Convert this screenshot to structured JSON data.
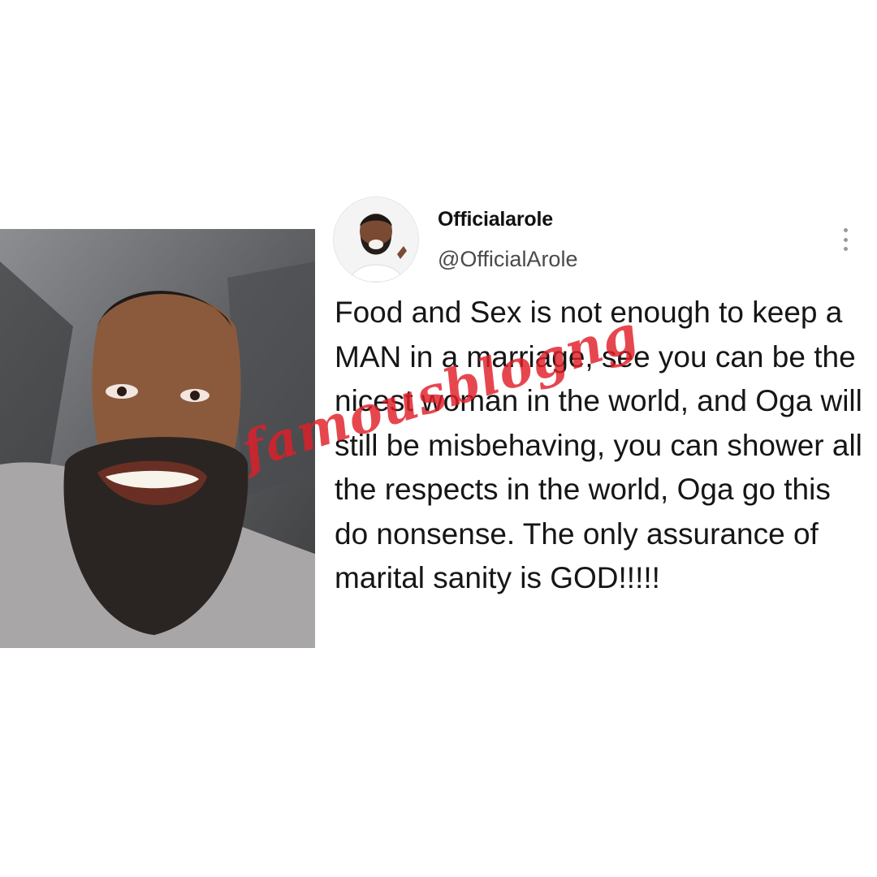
{
  "tweet": {
    "display_name": "Officialarole",
    "handle": "@OfficialArole",
    "text": "Food and Sex is not enough to keep a MAN in a marriage, see you can be the nicest woman in the world, and Oga will still be misbehaving, you can shower all the respects in the world, Oga go this do nonsense. The only assurance of marital sanity is GOD!!!!!",
    "more_icon": "vertical-ellipsis-icon"
  },
  "watermark": {
    "text": "famousblogng",
    "color": "#e11e28"
  },
  "colors": {
    "background": "#ffffff",
    "text": "#161616",
    "handle": "#4a4a4a"
  }
}
